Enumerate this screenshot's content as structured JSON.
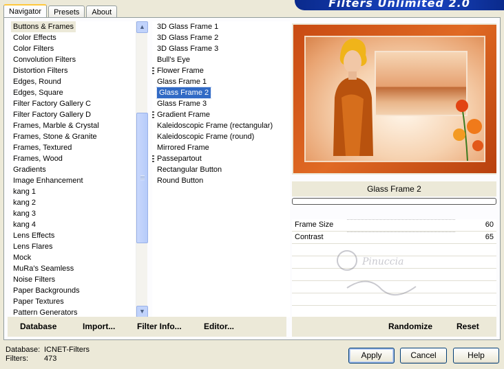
{
  "tabs": [
    "Navigator",
    "Presets",
    "About"
  ],
  "banner": "Filters Unlimited 2.0",
  "categories": [
    "Buttons & Frames",
    "Color Effects",
    "Color Filters",
    "Convolution Filters",
    "Distortion Filters",
    "Edges, Round",
    "Edges, Square",
    "Filter Factory Gallery C",
    "Filter Factory Gallery D",
    "Frames, Marble & Crystal",
    "Frames, Stone & Granite",
    "Frames, Textured",
    "Frames, Wood",
    "Gradients",
    "Image Enhancement",
    "kang 1",
    "kang 2",
    "kang 3",
    "kang 4",
    "Lens Effects",
    "Lens Flares",
    "Mock",
    "MuRa's Seamless",
    "Noise Filters",
    "Paper Backgrounds",
    "Paper Textures",
    "Pattern Generators"
  ],
  "selected_category": "Buttons & Frames",
  "filters": [
    {
      "label": "3D Glass Frame 1",
      "grip": false
    },
    {
      "label": "3D Glass Frame 2",
      "grip": false
    },
    {
      "label": "3D Glass Frame 3",
      "grip": false
    },
    {
      "label": "Bull's Eye",
      "grip": false
    },
    {
      "label": "Flower Frame",
      "grip": true
    },
    {
      "label": "Glass Frame 1",
      "grip": false
    },
    {
      "label": "Glass Frame 2",
      "grip": false
    },
    {
      "label": "Glass Frame 3",
      "grip": false
    },
    {
      "label": "Gradient Frame",
      "grip": true
    },
    {
      "label": "Kaleidoscopic Frame (rectangular)",
      "grip": false
    },
    {
      "label": "Kaleidoscopic Frame (round)",
      "grip": false
    },
    {
      "label": "Mirrored Frame",
      "grip": false
    },
    {
      "label": "Passepartout",
      "grip": true
    },
    {
      "label": "Rectangular Button",
      "grip": false
    },
    {
      "label": "Round Button",
      "grip": false
    }
  ],
  "selected_filter": "Glass Frame 2",
  "left_buttons": {
    "database": "Database",
    "import": "Import...",
    "filter_info": "Filter Info...",
    "editor": "Editor..."
  },
  "filter_title": "Glass Frame 2",
  "params": [
    {
      "name": "Frame Size",
      "value": "60"
    },
    {
      "name": "Contrast",
      "value": "65"
    }
  ],
  "watermark": "Pinuccia",
  "right_buttons": {
    "randomize": "Randomize",
    "reset": "Reset"
  },
  "status": {
    "database_label": "Database:",
    "database_value": "ICNET-Filters",
    "filters_label": "Filters:",
    "filters_value": "473"
  },
  "dialog_buttons": {
    "apply": "Apply",
    "cancel": "Cancel",
    "help": "Help"
  },
  "colors": {
    "selection": "#316ac5",
    "banner": "#1a46c4",
    "frame": "#c84a12"
  }
}
